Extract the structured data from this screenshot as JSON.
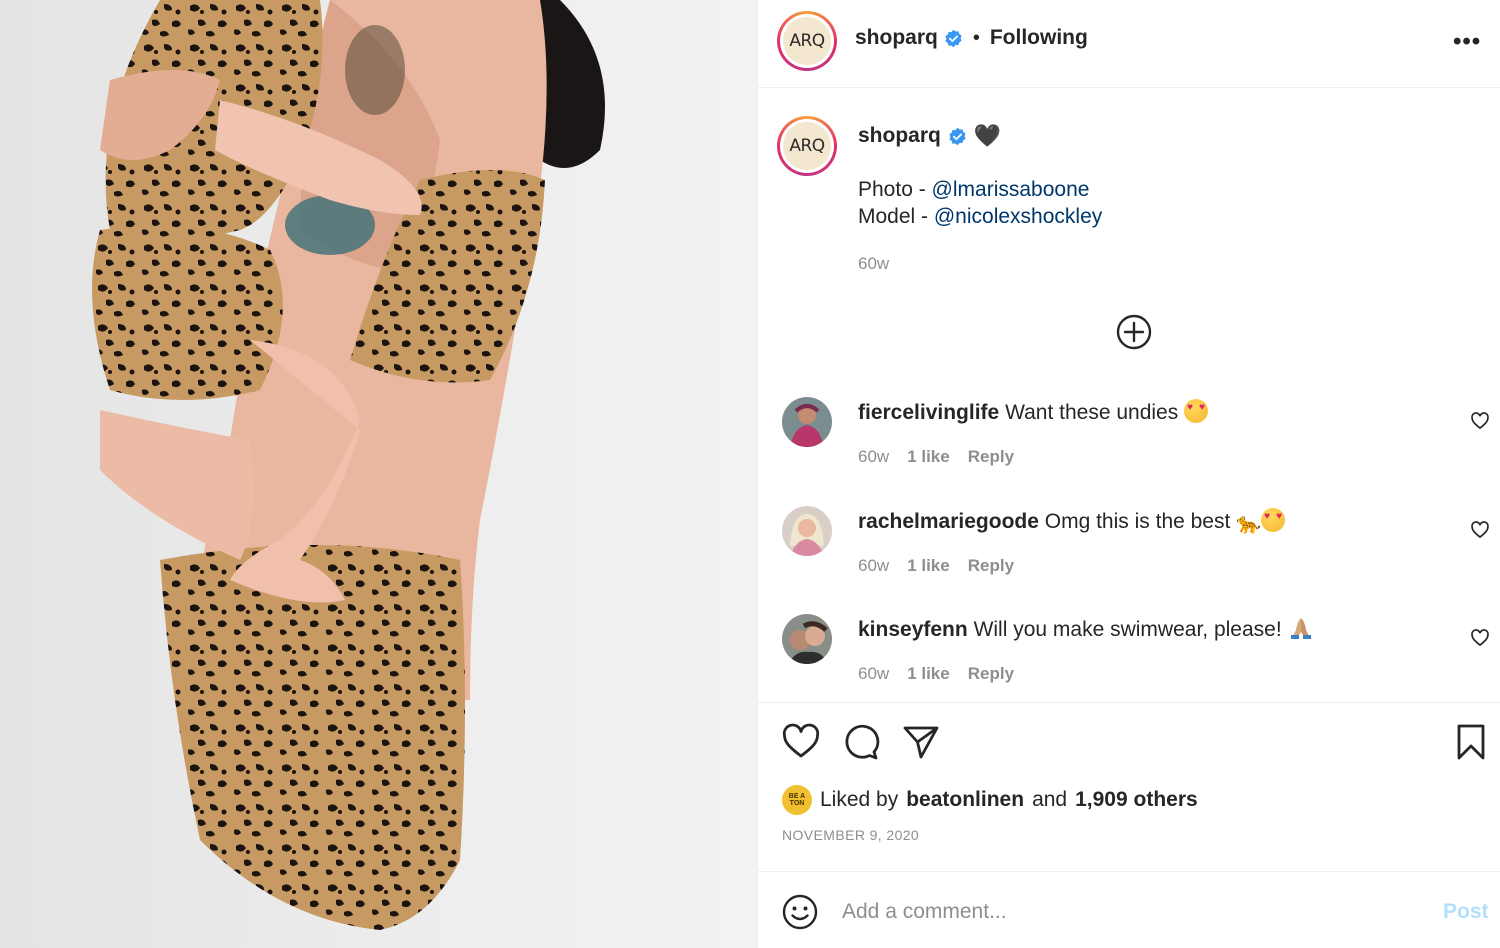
{
  "header": {
    "avatar_text": "ARQ",
    "username": "shoparq",
    "separator": "•",
    "follow_status": "Following",
    "more_icon": "more-horizontal-icon"
  },
  "caption": {
    "avatar_text": "ARQ",
    "username": "shoparq",
    "heart": "🖤",
    "line1_prefix": "Photo - ",
    "line1_mention": "@lmarissaboone",
    "line2_prefix": "Model - ",
    "line2_mention": "@nicolexshockley",
    "time": "60w"
  },
  "load_more_icon": "plus-circle-icon",
  "comments": [
    {
      "username": "fiercelivinglife",
      "text": "Want these undies",
      "emoji": "heart-eyes",
      "time": "60w",
      "likes": "1 like",
      "reply": "Reply"
    },
    {
      "username": "rachelmariegoode",
      "text": "Omg this is the best",
      "emoji": "leopard heart-eyes",
      "time": "60w",
      "likes": "1 like",
      "reply": "Reply"
    },
    {
      "username": "kinseyfenn",
      "text": "Will you make swimwear, please!",
      "emoji": "folded-hands",
      "time": "60w",
      "likes": "1 like",
      "reply": "Reply"
    }
  ],
  "actions": {
    "like_icon": "heart-icon",
    "comment_icon": "comment-icon",
    "share_icon": "paper-plane-icon",
    "save_icon": "bookmark-icon"
  },
  "likes": {
    "prefix": "Liked by",
    "user": "beatonlinen",
    "middle": "and",
    "others": "1,909 others",
    "avatar_text": "BE A TON"
  },
  "date": "NOVEMBER 9, 2020",
  "add_comment": {
    "placeholder": "Add a comment...",
    "post_label": "Post"
  },
  "colors": {
    "mention": "#00376b",
    "secondary_text": "#8e8e8e",
    "post_disabled": "#b2dffc",
    "verified": "#3897f0"
  }
}
